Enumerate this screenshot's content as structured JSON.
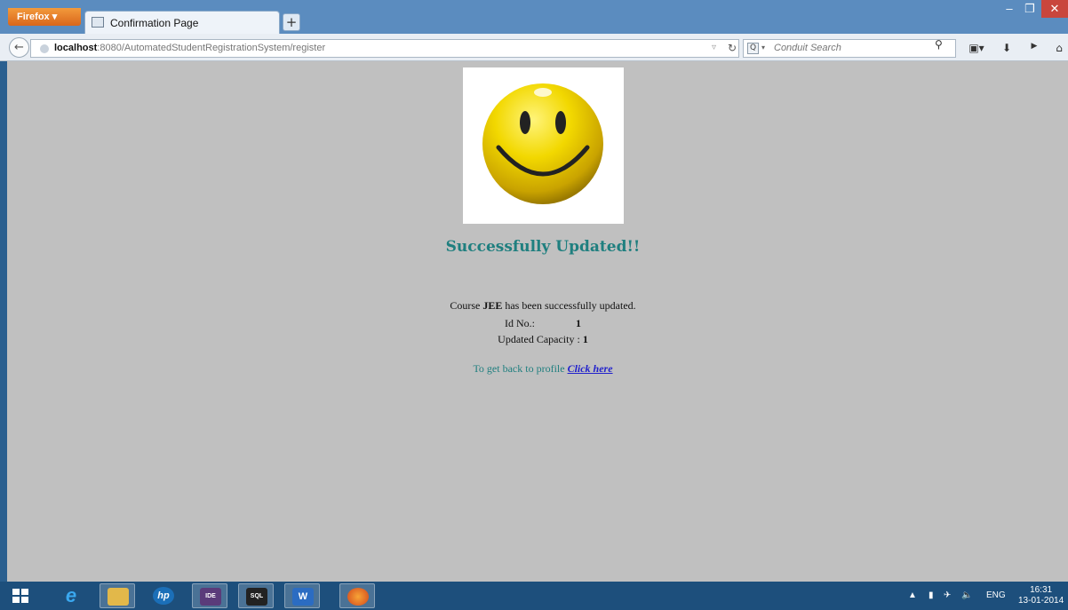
{
  "browser": {
    "app_button": "Firefox",
    "tab_title": "Confirmation Page",
    "new_tab": "+",
    "url_host": "localhost",
    "url_path": ":8080/AutomatedStudentRegistrationSystem/register",
    "search_placeholder": "Conduit Search"
  },
  "page": {
    "heading": "Successfully Updated!!",
    "course_prefix": "Course ",
    "course_name": "JEE",
    "course_suffix": " has been successfully updated.",
    "id_label": "Id No.:",
    "id_value": "1",
    "capacity_label": "Updated Capacity :",
    "capacity_value": "1",
    "back_text": "To get back to profile",
    "back_link": "Click here"
  },
  "taskbar": {
    "tray_language": "ENG",
    "time": "16:31",
    "date": "13-01-2014"
  },
  "colors": {
    "heading": "#1f7f7f",
    "link": "#2222cc",
    "page_background": "#c0c0c0"
  }
}
